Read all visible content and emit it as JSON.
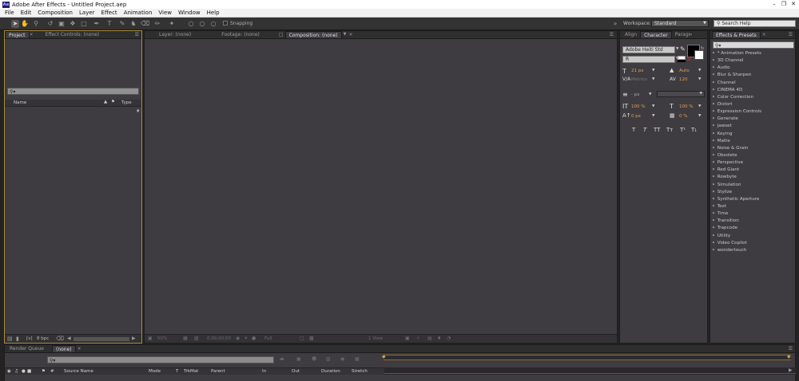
{
  "window": {
    "title": "Adobe After Effects - Untitled Project.aep",
    "app_icon": "Ae"
  },
  "menu": [
    "File",
    "Edit",
    "Composition",
    "Layer",
    "Effect",
    "Animation",
    "View",
    "Window",
    "Help"
  ],
  "toolbar": {
    "snapping_label": "Snapping",
    "workspace_label": "Workspace:",
    "workspace_value": "Standard",
    "search_help_placeholder": "Search Help"
  },
  "project_panel": {
    "tabs": [
      "Project",
      "Effect Controls: (none)"
    ],
    "search_placeholder": "",
    "columns": {
      "name": "Name",
      "type": "Type"
    },
    "footer": {
      "bpc": "8 bpc"
    }
  },
  "viewer": {
    "tabs": [
      "Layer: (none)",
      "Footage: (none)",
      "Composition: (none)"
    ],
    "zoom": "50%",
    "timecode": "0;00;00;00",
    "resolution": "Full",
    "views": "1 View"
  },
  "character_panel": {
    "tabs": [
      "Align",
      "Character",
      "Paragraph"
    ],
    "font_family": "Adobe Heiti Std",
    "font_style": "R",
    "font_size": "21 px",
    "leading": "Auto",
    "kerning": "Metrics",
    "tracking": "120",
    "stroke_width": "- px",
    "vertical_scale": "100 %",
    "horizontal_scale": "100 %",
    "baseline_shift": "0 px",
    "tsume": "0 %",
    "style_buttons": [
      "T",
      "T",
      "TT",
      "Tт",
      "T¹",
      "T₁"
    ]
  },
  "effects_panel": {
    "tab": "Effects & Presets",
    "search_placeholder": "",
    "items": [
      "* Animation Presets",
      "3D Channel",
      "Audio",
      "Blur & Sharpen",
      "Channel",
      "CINEMA 4D",
      "Color Correction",
      "Distort",
      "Expression Controls",
      "Generate",
      "jawset",
      "Keying",
      "Matte",
      "Noise & Grain",
      "Obsolete",
      "Perspective",
      "Red Giant",
      "Rowbyte",
      "Simulation",
      "Stylize",
      "Synthetic Aperture",
      "Text",
      "Time",
      "Transition",
      "Trapcode",
      "Utility",
      "Video Copilot",
      "wondertouch"
    ]
  },
  "timeline": {
    "tabs": [
      "Render Queue",
      "(none)"
    ],
    "columns": [
      "Source Name",
      "Mode",
      "T",
      "TrkMat",
      "Parent",
      "In",
      "Out",
      "Duration",
      "Stretch"
    ]
  }
}
